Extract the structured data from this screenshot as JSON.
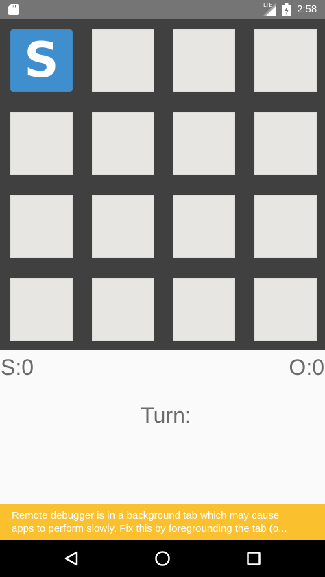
{
  "status_bar": {
    "network_label": "LTE",
    "time": "2:58",
    "icons": [
      "sd-card-icon",
      "signal-icon",
      "battery-charging-icon"
    ]
  },
  "board": {
    "rows": 4,
    "cols": 4,
    "cells": [
      {
        "mark": "S"
      },
      {
        "mark": ""
      },
      {
        "mark": ""
      },
      {
        "mark": ""
      },
      {
        "mark": ""
      },
      {
        "mark": ""
      },
      {
        "mark": ""
      },
      {
        "mark": ""
      },
      {
        "mark": ""
      },
      {
        "mark": ""
      },
      {
        "mark": ""
      },
      {
        "mark": ""
      },
      {
        "mark": ""
      },
      {
        "mark": ""
      },
      {
        "mark": ""
      },
      {
        "mark": ""
      }
    ],
    "colors": {
      "background": "#404040",
      "empty_cell": "#e7e6e3",
      "filled_cell": "#3f8fce"
    }
  },
  "scores": {
    "left": "S:0",
    "right": "O:0"
  },
  "turn_label": "Turn:",
  "banner": {
    "line1": "Remote debugger is in a background tab which may cause",
    "line2": "apps to perform slowly. Fix this by foregrounding the tab (o...",
    "color": "#fbc02d"
  },
  "nav_bar": {
    "icons": [
      "back-icon",
      "home-icon",
      "recents-icon"
    ]
  }
}
